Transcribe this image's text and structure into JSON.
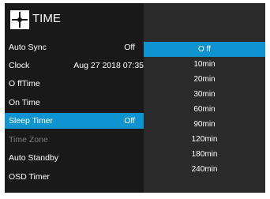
{
  "header": {
    "title": "TIME",
    "icon": "time-icon"
  },
  "menu": {
    "items": [
      {
        "label": "Auto Sync",
        "value": "Off"
      },
      {
        "label": "Clock",
        "value": "Aug 27 2018 07:35"
      },
      {
        "label": "O ffTime",
        "value": ""
      },
      {
        "label": "On Time",
        "value": ""
      },
      {
        "label": "Sleep Timer",
        "value": "Off"
      },
      {
        "label": "Time Zone",
        "value": ""
      },
      {
        "label": "Auto Standby",
        "value": ""
      },
      {
        "label": "OSD Timer",
        "value": ""
      }
    ],
    "selected": "Sleep Timer",
    "disabled": "Time Zone"
  },
  "submenu": {
    "title": "Sleep Timer",
    "selected": "O ff",
    "options": [
      "O ff",
      "10min",
      "20min",
      "30min",
      "60min",
      "90min",
      "120min",
      "180min",
      "240min"
    ]
  },
  "colors": {
    "background": "#151515",
    "selection": "#0f94d1",
    "text": "#ffffff",
    "disabled_text": "#7d7d7d"
  }
}
